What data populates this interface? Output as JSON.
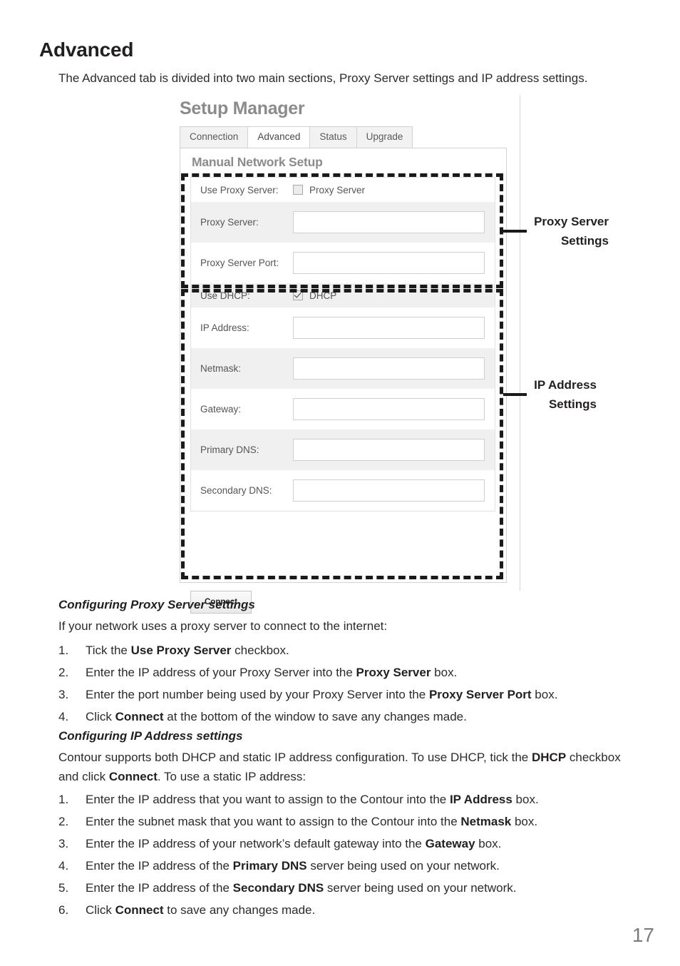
{
  "page": {
    "title": "Advanced",
    "intro": "The Advanced tab is divided into two main sections, Proxy Server settings and IP address settings.",
    "number": "17"
  },
  "screenshot": {
    "app_title": "Setup Manager",
    "tabs": [
      {
        "label": "Connection",
        "active": false
      },
      {
        "label": "Advanced",
        "active": true
      },
      {
        "label": "Status",
        "active": false
      },
      {
        "label": "Upgrade",
        "active": false
      }
    ],
    "panel_heading": "Manual Network Setup",
    "rows": [
      {
        "label": "Use Proxy Server:",
        "type": "checkbox",
        "check_label": "Proxy Server",
        "checked": false,
        "value": ""
      },
      {
        "label": "Proxy Server:",
        "type": "text",
        "value": "",
        "placeholder": ""
      },
      {
        "label": "Proxy Server Port:",
        "type": "text",
        "value": "",
        "placeholder": ""
      },
      {
        "label": "Use DHCP:",
        "type": "checkbox",
        "check_label": "DHCP",
        "checked": true,
        "value": ""
      },
      {
        "label": "IP Address:",
        "type": "text",
        "value": "",
        "placeholder": ""
      },
      {
        "label": "Netmask:",
        "type": "text",
        "value": "",
        "placeholder": ""
      },
      {
        "label": "Gateway:",
        "type": "text",
        "value": "",
        "placeholder": ""
      },
      {
        "label": "Primary DNS:",
        "type": "text",
        "value": "",
        "placeholder": ""
      },
      {
        "label": "Secondary DNS:",
        "type": "text",
        "value": "",
        "placeholder": ""
      }
    ],
    "connect_label": "Connect"
  },
  "callouts": {
    "proxy": "Proxy Server\nSettings",
    "ip": "IP Address\nSettings"
  },
  "sections": {
    "proxy": {
      "subhead": "Configuring Proxy Server settings",
      "lead": "If your network uses a proxy server to connect to the internet:",
      "steps": [
        {
          "num": "1.",
          "html": "Tick the <b>Use Proxy Server</b> checkbox."
        },
        {
          "num": "2.",
          "html": "Enter the IP address of your Proxy Server into the <b>Proxy Server</b> box."
        },
        {
          "num": "3.",
          "html": "Enter the port number being used by your Proxy Server into the <b>Proxy Server Port</b> box."
        },
        {
          "num": "4.",
          "html": "Click <b>Connect</b> at the bottom of the window to save any changes made."
        }
      ]
    },
    "ip": {
      "subhead": "Configuring IP Address settings",
      "lead": "Contour supports both DHCP and static IP address configuration. To use DHCP, tick the <b>DHCP</b> checkbox and click <b>Connect</b>. To use a static IP address:",
      "steps": [
        {
          "num": "1.",
          "html": "Enter the IP address that you want to assign to the Contour into the <b>IP Address</b> box."
        },
        {
          "num": "2.",
          "html": "Enter the subnet mask that you want to assign to the Contour into the <b>Netmask</b> box."
        },
        {
          "num": "3.",
          "html": "Enter the IP address of your network’s default gateway into the <b>Gateway</b> box."
        },
        {
          "num": "4.",
          "html": "Enter the IP address of the <b>Primary DNS</b> server being used on your network."
        },
        {
          "num": "5.",
          "html": "Enter the IP address of the <b>Secondary DNS</b> server being used on your network."
        },
        {
          "num": "6.",
          "html": "Click <b>Connect</b> to save any changes made."
        }
      ]
    }
  },
  "colors": {
    "ink": "#231f20",
    "muted_heading": "#8b8b8b",
    "form_label": "#555555",
    "alt_row": "#f0f0f0",
    "annotation": "#1a1a1a",
    "page_number": "#7c7c7c"
  }
}
